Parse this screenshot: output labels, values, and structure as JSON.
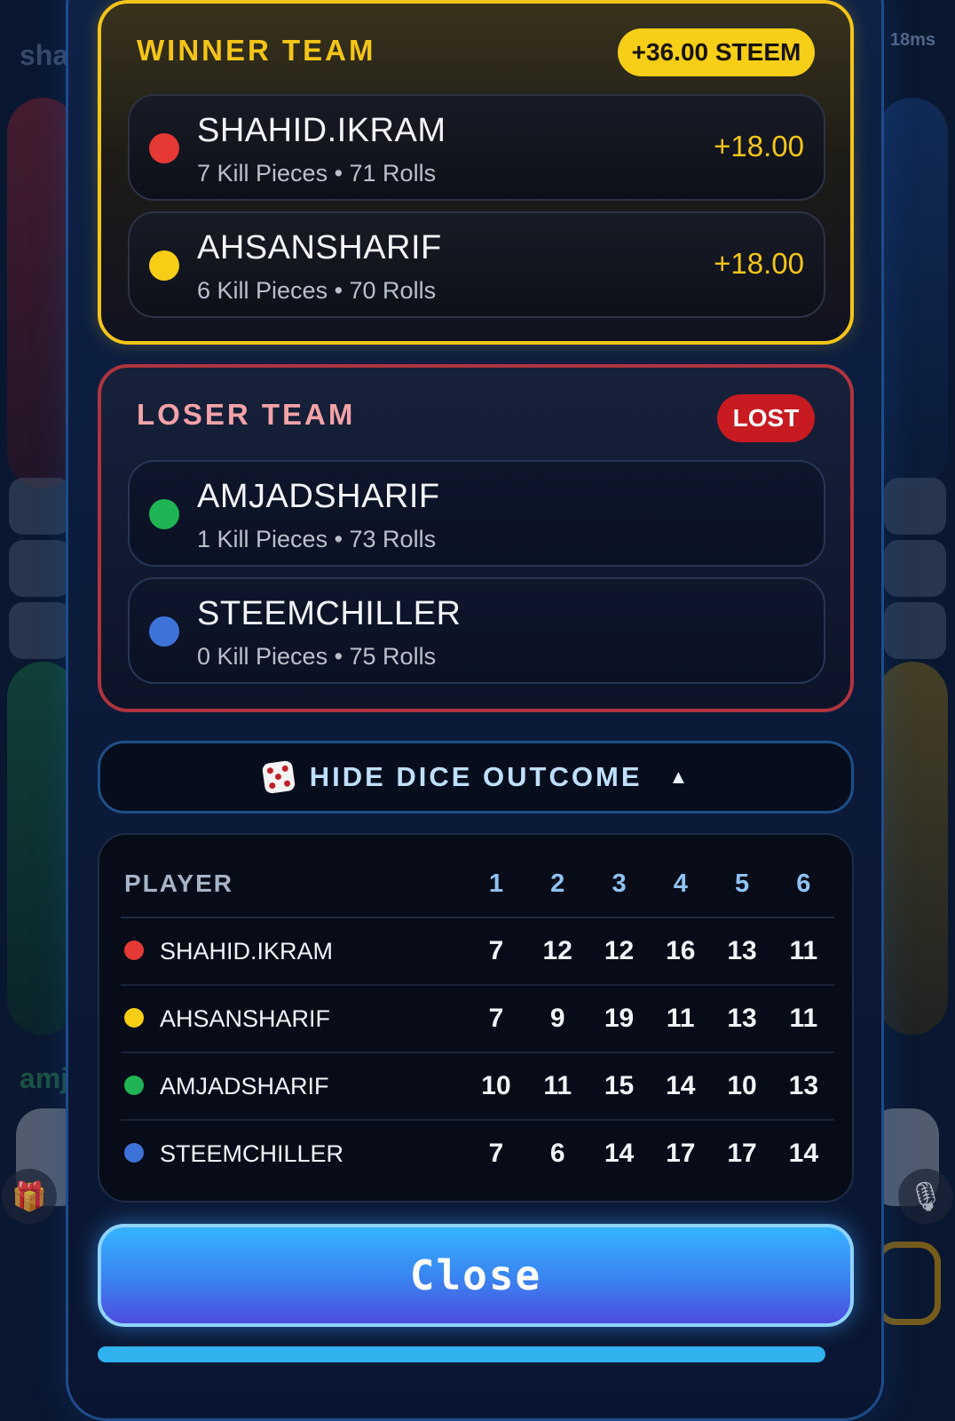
{
  "background": {
    "top_player_name": "sha",
    "bottom_player_name": "amj",
    "latency": "18ms",
    "gift_icon": "gift-icon",
    "mic_icon": "microphone-icon"
  },
  "winner": {
    "title": "WINNER TEAM",
    "badge": "+36.00 STEEM",
    "players": [
      {
        "name": "SHAHID.IKRAM",
        "stats": "7 Kill Pieces • 71 Rolls",
        "amount": "+18.00",
        "color": "#e53935"
      },
      {
        "name": "AHSANSHARIF",
        "stats": "6 Kill Pieces • 70 Rolls",
        "amount": "+18.00",
        "color": "#f7cd16"
      }
    ]
  },
  "loser": {
    "title": "LOSER TEAM",
    "badge": "LOST",
    "players": [
      {
        "name": "AMJADSHARIF",
        "stats": "1 Kill Pieces • 73 Rolls",
        "color": "#1fb454"
      },
      {
        "name": "STEEMCHILLER",
        "stats": "0 Kill Pieces • 75 Rolls",
        "color": "#3d73d9"
      }
    ]
  },
  "dice_toggle": {
    "icon": "dice-icon",
    "label": "HIDE DICE OUTCOME",
    "arrow": "▲"
  },
  "dice_table": {
    "headers": [
      "PLAYER",
      "1",
      "2",
      "3",
      "4",
      "5",
      "6"
    ],
    "rows": [
      {
        "name": "SHAHID.IKRAM",
        "color": "#e53935",
        "values": [
          "7",
          "12",
          "12",
          "16",
          "13",
          "11"
        ]
      },
      {
        "name": "AHSANSHARIF",
        "color": "#f7cd16",
        "values": [
          "7",
          "9",
          "19",
          "11",
          "13",
          "11"
        ]
      },
      {
        "name": "AMJADSHARIF",
        "color": "#1fb454",
        "values": [
          "10",
          "11",
          "15",
          "14",
          "10",
          "13"
        ]
      },
      {
        "name": "STEEMCHILLER",
        "color": "#3d73d9",
        "values": [
          "7",
          "6",
          "14",
          "17",
          "17",
          "14"
        ]
      }
    ]
  },
  "close_button": {
    "label": "Close"
  },
  "progress": {
    "value": 1.0
  }
}
